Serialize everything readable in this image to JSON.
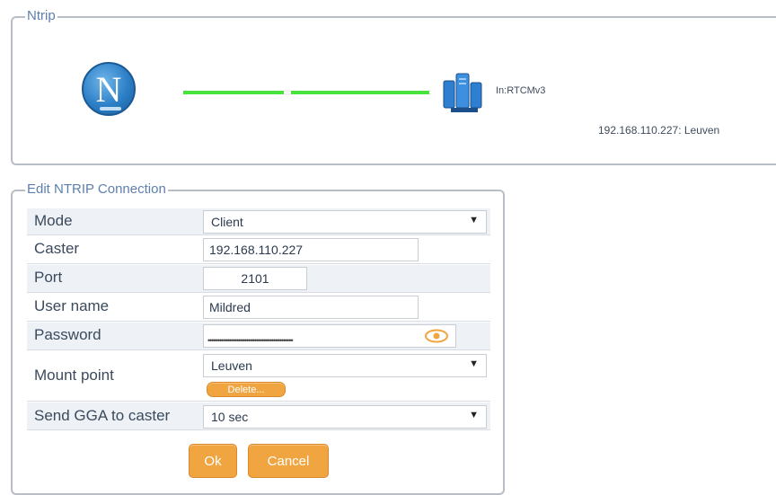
{
  "ntrip_panel": {
    "legend": "Ntrip",
    "server_label": "In:RTCMv3",
    "caster_info": "192.168.110.227: Leuven",
    "logo_letter": "N"
  },
  "edit_panel": {
    "legend": "Edit NTRIP Connection",
    "mode": {
      "label": "Mode",
      "value": "Client"
    },
    "caster": {
      "label": "Caster",
      "value": "192.168.110.227"
    },
    "port": {
      "label": "Port",
      "value": "2101"
    },
    "username": {
      "label": "User name",
      "value": "Mildred"
    },
    "password": {
      "label": "Password",
      "value": "••••••••••••••••••••••••••••••••••••••••••••"
    },
    "mount_point": {
      "label": "Mount point",
      "value": "Leuven",
      "delete_label": "Delete..."
    },
    "send_gga": {
      "label": "Send GGA to caster",
      "value": "10 sec"
    },
    "ok_label": "Ok",
    "cancel_label": "Cancel",
    "dropdown_arrow": "▼"
  },
  "colors": {
    "accent": "#f0a540",
    "legend": "#5d7fae",
    "link_line": "#48e23c",
    "logo": "#2c7fc6"
  }
}
